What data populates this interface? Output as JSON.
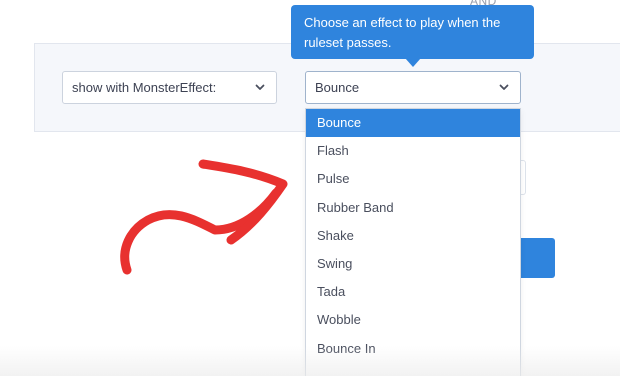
{
  "header": {
    "and_label": "AND"
  },
  "rule": {
    "condition_select": {
      "value": "show with MonsterEffect:",
      "icon": "chevron-down-icon"
    },
    "effect_select": {
      "value": "Bounce",
      "icon": "chevron-down-icon"
    }
  },
  "tooltip": {
    "text": "Choose an effect to play when the ruleset passes."
  },
  "dropdown": {
    "options": [
      {
        "label": "Bounce",
        "selected": true
      },
      {
        "label": "Flash"
      },
      {
        "label": "Pulse"
      },
      {
        "label": "Rubber Band"
      },
      {
        "label": "Shake"
      },
      {
        "label": "Swing"
      },
      {
        "label": "Tada"
      },
      {
        "label": "Wobble"
      },
      {
        "label": "Bounce In"
      }
    ]
  },
  "annotation": {
    "arrow_color": "#e8312f"
  },
  "colors": {
    "accent": "#2f84dd",
    "panel_bg": "#f5f7fb"
  }
}
